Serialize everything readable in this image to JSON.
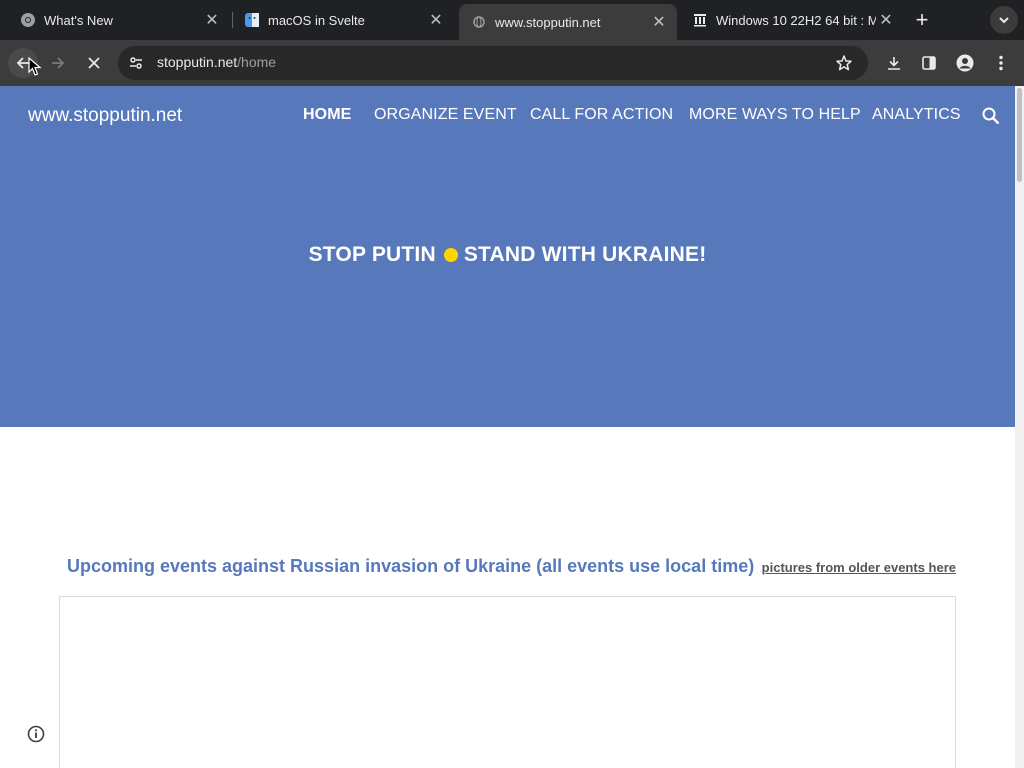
{
  "browser": {
    "tabs": [
      {
        "title": "What's New",
        "favicon": "chrome-icon",
        "active": false
      },
      {
        "title": "macOS in Svelte",
        "favicon": "finder-icon",
        "active": false
      },
      {
        "title": "www.stopputin.net",
        "favicon": "loading-globe-icon",
        "active": true
      },
      {
        "title": "Windows 10 22H2 64 bit : M",
        "favicon": "archive-org-icon",
        "active": false
      }
    ],
    "new_tab_icon": "plus-icon",
    "tab_search_icon": "chevron-down-icon",
    "address": {
      "host": "stopputin.net",
      "path": "/home"
    },
    "toolbar_icons": [
      "back-icon",
      "forward-icon",
      "stop-loading-icon",
      "site-info-icon",
      "bookmark-star-icon",
      "download-icon",
      "side-panel-icon",
      "profile-icon",
      "menu-icon"
    ]
  },
  "site": {
    "title": "www.stopputin.net",
    "nav": [
      {
        "label": "HOME",
        "active": true
      },
      {
        "label": "ORGANIZE EVENT",
        "active": false
      },
      {
        "label": "CALL FOR ACTION",
        "active": false
      },
      {
        "label": "MORE WAYS TO HELP",
        "active": false
      },
      {
        "label": "ANALYTICS",
        "active": false
      }
    ],
    "banner_left": "STOP PUTIN",
    "banner_right": "STAND WITH UKRAINE!",
    "colors": {
      "hero": "#5779bc",
      "dot": "#ffd500",
      "heading": "#5779bc"
    }
  },
  "events": {
    "heading": "Upcoming events against Russian invasion of Ukraine (all events use local time)",
    "older_link": "pictures from older events here"
  }
}
